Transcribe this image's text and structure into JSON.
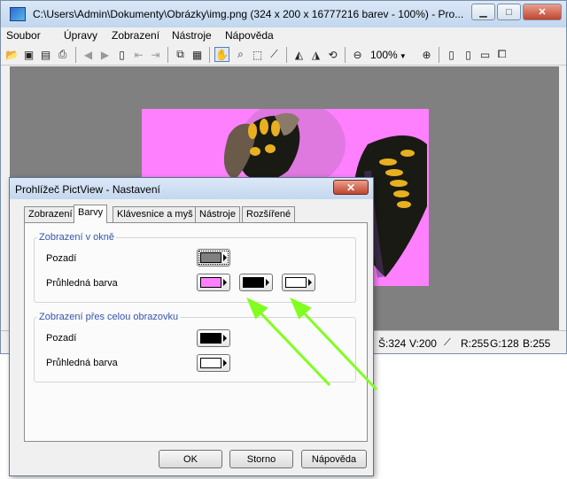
{
  "main_window": {
    "title": "C:\\Users\\Admin\\Dokumenty\\Obrázky\\img.png (324 x 200 x 16777216 barev - 100%) - Pro...",
    "icon": "app-icon",
    "controls": {
      "minimize": "minimize-icon",
      "maximize": "maximize-icon",
      "close": "close-icon"
    }
  },
  "menu": [
    "Soubor",
    "Úpravy",
    "Zobrazení",
    "Nástroje",
    "Nápověda"
  ],
  "toolbar": {
    "zoom_label": "100%",
    "icons": [
      "open-icon",
      "save-icon",
      "save-as-icon",
      "print-icon",
      "prev-icon",
      "next-icon",
      "page-icon",
      "first-icon",
      "last-icon",
      "copy-icon",
      "paste-icon",
      "hand-icon",
      "zoom-icon",
      "select-icon",
      "pipette-icon",
      "flip-h-icon",
      "flip-v-icon",
      "rotate-icon",
      "zoom-out-icon",
      "zoom-in-icon",
      "fit-icon",
      "fit-width-icon",
      "fullscreen-icon",
      "window-icon"
    ]
  },
  "status": {
    "width": "Š:324",
    "height": "V:200",
    "r": "R:255",
    "g": "G:128",
    "b": "B:255"
  },
  "dialog": {
    "title": "Prohlížeč PictView - Nastavení",
    "tabs": [
      "Zobrazení",
      "Barvy",
      "Klávesnice a myš",
      "Nástroje",
      "Rozšířené"
    ],
    "active_tab": "Barvy",
    "group1": {
      "label": "Zobrazení v okně",
      "background_label": "Pozadí",
      "transparent_label": "Průhledná barva"
    },
    "group2": {
      "label": "Zobrazení přes celou obrazovku",
      "background_label": "Pozadí",
      "transparent_label": "Průhledná barva"
    },
    "buttons": {
      "ok": "OK",
      "cancel": "Storno",
      "help": "Nápověda"
    }
  },
  "colors": {
    "window_bg": "#808080",
    "image_bg": "#ff80ff",
    "swatch_gray": "#808080",
    "swatch_pink": "#ff80ff",
    "swatch_black": "#000000",
    "swatch_white": "#ffffff",
    "arrow": "#80ff20"
  }
}
